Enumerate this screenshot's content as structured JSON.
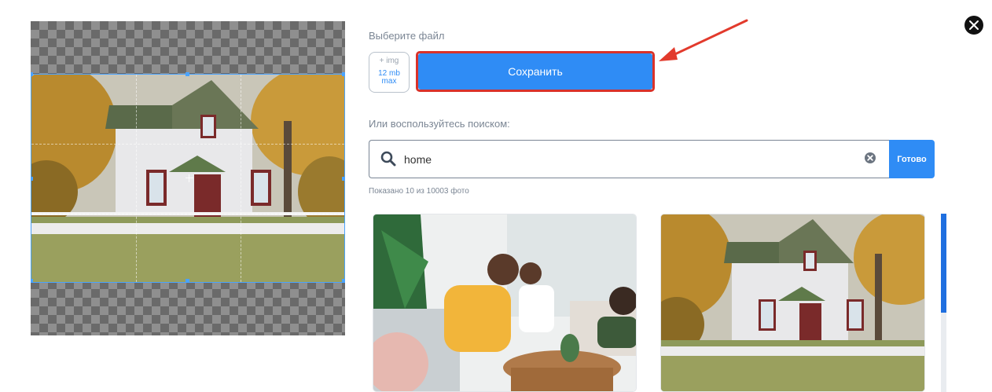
{
  "uploader": {
    "choose_file_label": "Выберите файл",
    "upload_type": "+ img",
    "upload_limit": "12 mb\nmax",
    "save_label": "Сохранить"
  },
  "search": {
    "label": "Или воспользуйтесь поиском:",
    "query": "home",
    "done_label": "Готово",
    "result_count": "Показано 10 из 10003 фото"
  },
  "icons": {
    "close": "close-icon",
    "search": "search-icon",
    "clear": "clear-icon",
    "annotation": "red-arrow-icon"
  },
  "results": [
    {
      "kind": "family-photo"
    },
    {
      "kind": "house-photo"
    }
  ],
  "colors": {
    "accent": "#2f8cf5",
    "highlight": "#d9322a",
    "scroll_thumb": "#1f6fe0",
    "crop_border": "#4aa3ff"
  }
}
